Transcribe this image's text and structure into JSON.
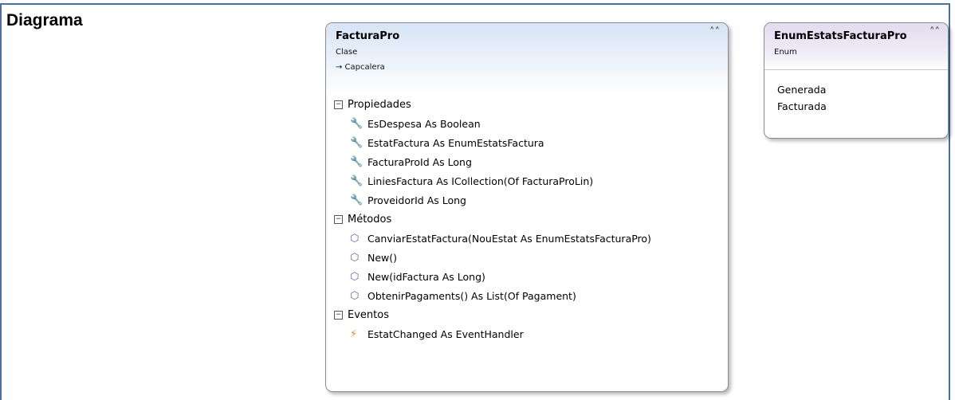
{
  "document": {
    "label": "Diagrama"
  },
  "class_shape": {
    "name": "FacturaPro",
    "stereotype": "Clase",
    "base_class": "→ Capcalera",
    "collapse_icon": "double-chevron-up-icon",
    "compartments": {
      "properties": {
        "title": "Propiedades",
        "items": [
          {
            "text": "EsDespesa As Boolean",
            "icon": "wrench-icon"
          },
          {
            "text": "EstatFactura As EnumEstatsFactura",
            "icon": "wrench-icon"
          },
          {
            "text": "FacturaProId As Long",
            "icon": "wrench-icon"
          },
          {
            "text": "LiniesFactura As ICollection(Of FacturaProLin)",
            "icon": "wrench-icon"
          },
          {
            "text": "ProveidorId As Long",
            "icon": "wrench-icon"
          }
        ]
      },
      "methods": {
        "title": "Métodos",
        "items": [
          {
            "text": "CanviarEstatFactura(NouEstat As EnumEstatsFacturaPro)",
            "icon": "private-method-icon"
          },
          {
            "text": "New()",
            "icon": "method-icon"
          },
          {
            "text": "New(idFactura As Long)",
            "icon": "method-icon"
          },
          {
            "text": "ObtenirPagaments() As List(Of Pagament)",
            "icon": "method-icon"
          }
        ]
      },
      "events": {
        "title": "Eventos",
        "items": [
          {
            "text": "EstatChanged As EventHandler",
            "icon": "lightning-icon"
          }
        ]
      }
    }
  },
  "enum_shape": {
    "name": "EnumEstatsFacturaPro",
    "stereotype": "Enum",
    "collapse_icon": "double-chevron-up-icon",
    "members": [
      "Generada",
      "Facturada"
    ]
  },
  "colors": {
    "frame": "#4a6fa5",
    "class_header": "#d7e4f5",
    "enum_header": "#e1dcef",
    "method_icon": "#7a52b3",
    "event_icon": "#e08a1e"
  }
}
